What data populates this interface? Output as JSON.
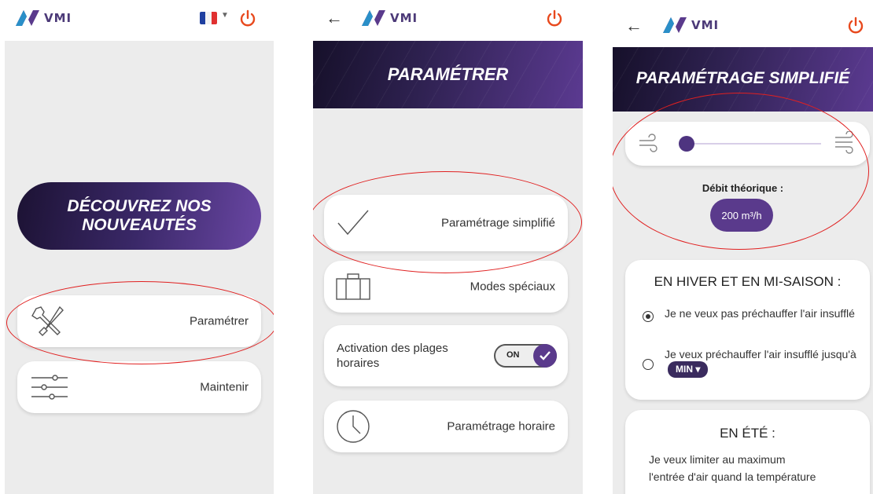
{
  "brand": {
    "logo_text": "VMI",
    "accent": "#5a3a8c",
    "dark": "#1c1233"
  },
  "annotation_color": "#e02020",
  "screen1": {
    "language_flag": "fr",
    "discover_line1": "DÉCOUVREZ NOS",
    "discover_line2": "NOUVEAUTÉS",
    "menu": [
      {
        "label": "Paramétrer",
        "icon": "tools-icon"
      },
      {
        "label": "Maintenir",
        "icon": "sliders-icon"
      }
    ]
  },
  "screen2": {
    "title": "PARAMÉTRER",
    "items": [
      {
        "label": "Paramétrage simplifié",
        "icon": "checkmark-icon"
      },
      {
        "label": "Modes spéciaux",
        "icon": "suitcase-icon"
      },
      {
        "label": "Activation des plages horaires",
        "toggle": "ON",
        "toggle_state": true
      },
      {
        "label": "Paramétrage horaire",
        "icon": "clock-icon"
      }
    ]
  },
  "screen3": {
    "title": "PARAMÉTRAGE SIMPLIFIÉ",
    "slider": {
      "level": 0.0
    },
    "debit_label": "Débit théorique :",
    "debit_value": "200 m³/h",
    "winter": {
      "title": "EN HIVER ET EN MI-SAISON :",
      "option1": "Je ne veux pas préchauffer l'air insufflé",
      "option2": "Je veux préchauffer l'air insufflé jusqu'à",
      "option2_select": "MIN",
      "selected": 0
    },
    "summer": {
      "title": "EN ÉTÉ :",
      "text_line1": "Je veux limiter au maximum",
      "text_line2": "l'entrée d'air quand la température"
    }
  }
}
